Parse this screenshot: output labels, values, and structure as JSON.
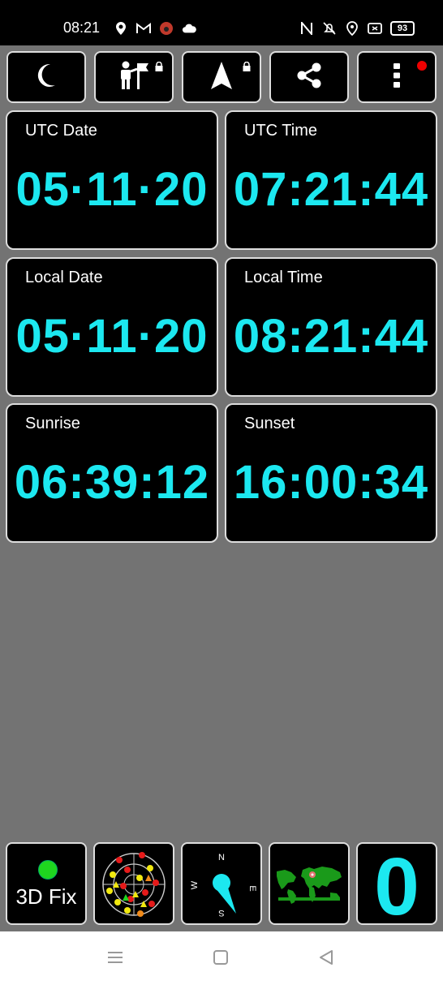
{
  "status_bar": {
    "time": "08:21",
    "battery": "93",
    "icons_left": [
      "location-pin-icon",
      "gmail-icon",
      "red-app-icon",
      "cloud-icon"
    ],
    "icons_right": [
      "nfc-icon",
      "bell-off-icon",
      "location-icon",
      "screen-icon"
    ]
  },
  "toolbar": {
    "buttons": [
      {
        "name": "night-mode-button",
        "icon": "moon-icon"
      },
      {
        "name": "waypoint-button",
        "icon": "person-flag-icon",
        "locked": true
      },
      {
        "name": "navigate-button",
        "icon": "arrow-up-icon",
        "locked": true
      },
      {
        "name": "share-button",
        "icon": "share-icon"
      },
      {
        "name": "more-menu-button",
        "icon": "vertical-dots-icon",
        "notification": true
      }
    ]
  },
  "tiles": {
    "utc_date": {
      "label": "UTC Date",
      "value": "05·11·20"
    },
    "utc_time": {
      "label": "UTC Time",
      "value": "07:21:44"
    },
    "local_date": {
      "label": "Local Date",
      "value": "05·11·20"
    },
    "local_time": {
      "label": "Local Time",
      "value": "08:21:44"
    },
    "sunrise": {
      "label": "Sunrise",
      "value": "06:39:12"
    },
    "sunset": {
      "label": "Sunset",
      "value": "16:00:34"
    }
  },
  "bottom_bar": {
    "fix_label": "3D Fix",
    "compass": {
      "n": "N",
      "e": "E",
      "s": "S",
      "w": "W"
    },
    "satellite_count": "0"
  },
  "colors": {
    "accent": "#1ce8f0",
    "background": "#737373",
    "tile_bg": "#000000",
    "fix_green": "#1fd61f"
  }
}
